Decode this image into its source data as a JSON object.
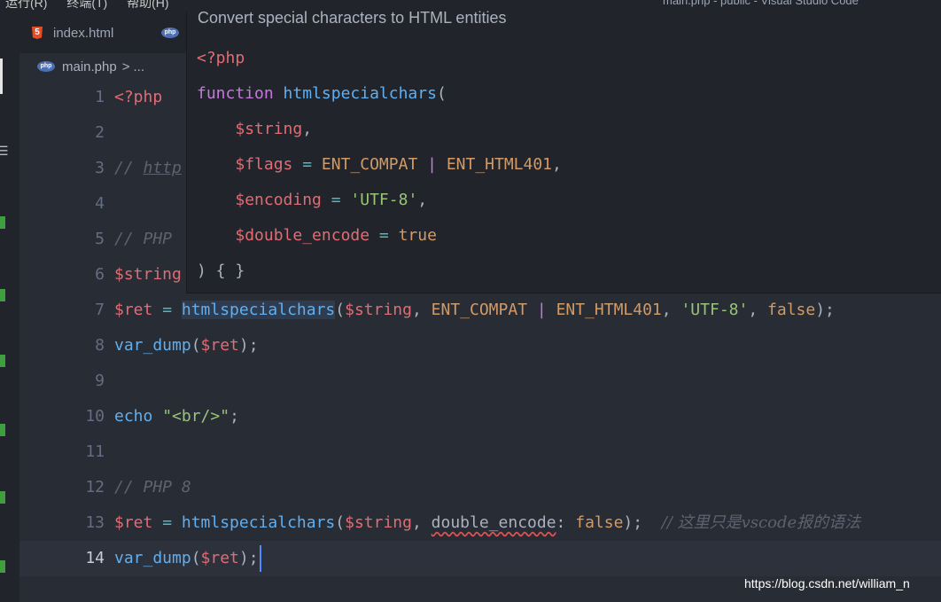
{
  "menubar": {
    "items": [
      "运行(R)",
      "终端(T)",
      "帮助(H)"
    ],
    "window_title": "main.php - public - Visual Studio Code"
  },
  "tabs": [
    {
      "label": "index.html",
      "icon": "html5-icon"
    },
    {
      "label": "",
      "icon": "php-icon"
    }
  ],
  "breadcrumb": {
    "file": "main.php",
    "separator": ">",
    "rest": "..."
  },
  "editor": {
    "lines": [
      {
        "n": "1",
        "tokens": [
          {
            "c": "tag",
            "t": "<?php"
          }
        ]
      },
      {
        "n": "2",
        "tokens": []
      },
      {
        "n": "3",
        "tokens": [
          {
            "c": "cm",
            "t": "// "
          },
          {
            "c": "cm u",
            "t": "http"
          }
        ]
      },
      {
        "n": "4",
        "tokens": []
      },
      {
        "n": "5",
        "tokens": [
          {
            "c": "cm",
            "t": "// PHP"
          }
        ]
      },
      {
        "n": "6",
        "tokens": [
          {
            "c": "var",
            "t": "$string"
          }
        ]
      },
      {
        "n": "7",
        "tokens": [
          {
            "c": "var",
            "t": "$ret"
          },
          {
            "c": "op",
            "t": " = "
          },
          {
            "c": "fn hl",
            "t": "htmlspecialchars"
          },
          {
            "c": "",
            "t": "("
          },
          {
            "c": "var",
            "t": "$string"
          },
          {
            "c": "",
            "t": ", "
          },
          {
            "c": "const",
            "t": "ENT_COMPAT"
          },
          {
            "c": "",
            "t": " "
          },
          {
            "c": "kw",
            "t": "|"
          },
          {
            "c": "",
            "t": " "
          },
          {
            "c": "const",
            "t": "ENT_HTML401"
          },
          {
            "c": "",
            "t": ", "
          },
          {
            "c": "str",
            "t": "'UTF-8'"
          },
          {
            "c": "",
            "t": ", "
          },
          {
            "c": "const",
            "t": "false"
          },
          {
            "c": "",
            "t": ");"
          }
        ]
      },
      {
        "n": "8",
        "tokens": [
          {
            "c": "fn",
            "t": "var_dump"
          },
          {
            "c": "",
            "t": "("
          },
          {
            "c": "var",
            "t": "$ret"
          },
          {
            "c": "",
            "t": ");"
          }
        ]
      },
      {
        "n": "9",
        "tokens": []
      },
      {
        "n": "10",
        "tokens": [
          {
            "c": "fn",
            "t": "echo"
          },
          {
            "c": "",
            "t": " "
          },
          {
            "c": "str",
            "t": "\"<br/>\""
          },
          {
            "c": "",
            "t": ";"
          }
        ]
      },
      {
        "n": "11",
        "tokens": []
      },
      {
        "n": "12",
        "tokens": [
          {
            "c": "cm",
            "t": "// PHP 8"
          }
        ]
      },
      {
        "n": "13",
        "tokens": [
          {
            "c": "var",
            "t": "$ret"
          },
          {
            "c": "op",
            "t": " = "
          },
          {
            "c": "fn",
            "t": "htmlspecialchars"
          },
          {
            "c": "",
            "t": "("
          },
          {
            "c": "var",
            "t": "$string"
          },
          {
            "c": "",
            "t": ", "
          },
          {
            "c": "squig",
            "t": "double_encode"
          },
          {
            "c": "",
            "t": ": "
          },
          {
            "c": "const",
            "t": "false"
          },
          {
            "c": "",
            "t": ");  "
          },
          {
            "c": "cm param-cm",
            "t": "// 这里只是vscode报的语法"
          }
        ]
      },
      {
        "n": "14",
        "tokens": [
          {
            "c": "fn",
            "t": "var_dump"
          },
          {
            "c": "",
            "t": "("
          },
          {
            "c": "var",
            "t": "$ret"
          },
          {
            "c": "",
            "t": ");"
          }
        ],
        "current": true
      }
    ]
  },
  "hover": {
    "description": "Convert special characters to HTML entities",
    "lines": [
      [
        {
          "c": "tag",
          "t": "<?php"
        }
      ],
      [
        {
          "c": "kw",
          "t": "function"
        },
        {
          "c": "",
          "t": " "
        },
        {
          "c": "fn",
          "t": "htmlspecialchars"
        },
        {
          "c": "",
          "t": "("
        }
      ],
      [
        {
          "c": "",
          "t": "    "
        },
        {
          "c": "var",
          "t": "$string"
        },
        {
          "c": "",
          "t": ","
        }
      ],
      [
        {
          "c": "",
          "t": "    "
        },
        {
          "c": "var",
          "t": "$flags"
        },
        {
          "c": "op",
          "t": " = "
        },
        {
          "c": "const",
          "t": "ENT_COMPAT"
        },
        {
          "c": "",
          "t": " "
        },
        {
          "c": "kw",
          "t": "|"
        },
        {
          "c": "",
          "t": " "
        },
        {
          "c": "const",
          "t": "ENT_HTML401"
        },
        {
          "c": "",
          "t": ","
        }
      ],
      [
        {
          "c": "",
          "t": "    "
        },
        {
          "c": "var",
          "t": "$encoding"
        },
        {
          "c": "op",
          "t": " = "
        },
        {
          "c": "str",
          "t": "'UTF-8'"
        },
        {
          "c": "",
          "t": ","
        }
      ],
      [
        {
          "c": "",
          "t": "    "
        },
        {
          "c": "var",
          "t": "$double_encode"
        },
        {
          "c": "op",
          "t": " = "
        },
        {
          "c": "const",
          "t": "true"
        }
      ],
      [
        {
          "c": "",
          "t": ") { }"
        }
      ]
    ]
  },
  "watermark": "https://blog.csdn.net/william_n"
}
